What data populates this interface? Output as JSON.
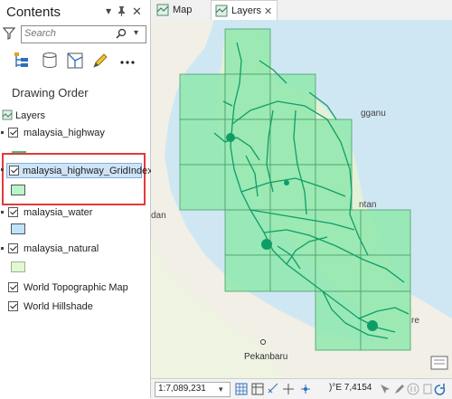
{
  "pane": {
    "title": "Contents",
    "header_icons": {
      "dropdown": "▾",
      "pin": "📌",
      "close": "✕"
    },
    "search_placeholder": "Search",
    "drawing_order": "Drawing Order",
    "layers_label": "Layers",
    "layers": [
      {
        "label": "malaysia_highway",
        "checked": true,
        "symbol": "line",
        "color": "#3fbf7f"
      },
      {
        "label": "malaysia_highway_GridIndex",
        "checked": true,
        "symbol": "fill",
        "color": "#b9f5c8",
        "selected": true
      },
      {
        "label": "malaysia_water",
        "checked": true,
        "symbol": "fill",
        "color": "#bee3fa"
      },
      {
        "label": "malaysia_natural",
        "checked": true,
        "symbol": "fill",
        "color": "#e3f7d4"
      },
      {
        "label": "World Topographic Map",
        "checked": true
      },
      {
        "label": "World Hillshade",
        "checked": true
      }
    ],
    "highlight_color": "#e23a3a"
  },
  "tabs": [
    {
      "label": "Map",
      "active": false
    },
    {
      "label": "Layers",
      "active": true,
      "close": "✕"
    }
  ],
  "map": {
    "labels": {
      "ganu": "gganu",
      "dan": "dan",
      "ntan": "ntan",
      "re": "re",
      "pekanbaru": "Pekanbaru"
    },
    "grid_color": "#7ee8a3",
    "road_color": "#0f9d66",
    "sea_color": "#cfe7f3",
    "land_color": "#f3f1e9"
  },
  "status": {
    "scale": "1:7,089,231",
    "coords": ")°E 7,4154",
    "dropdown": "▾"
  }
}
